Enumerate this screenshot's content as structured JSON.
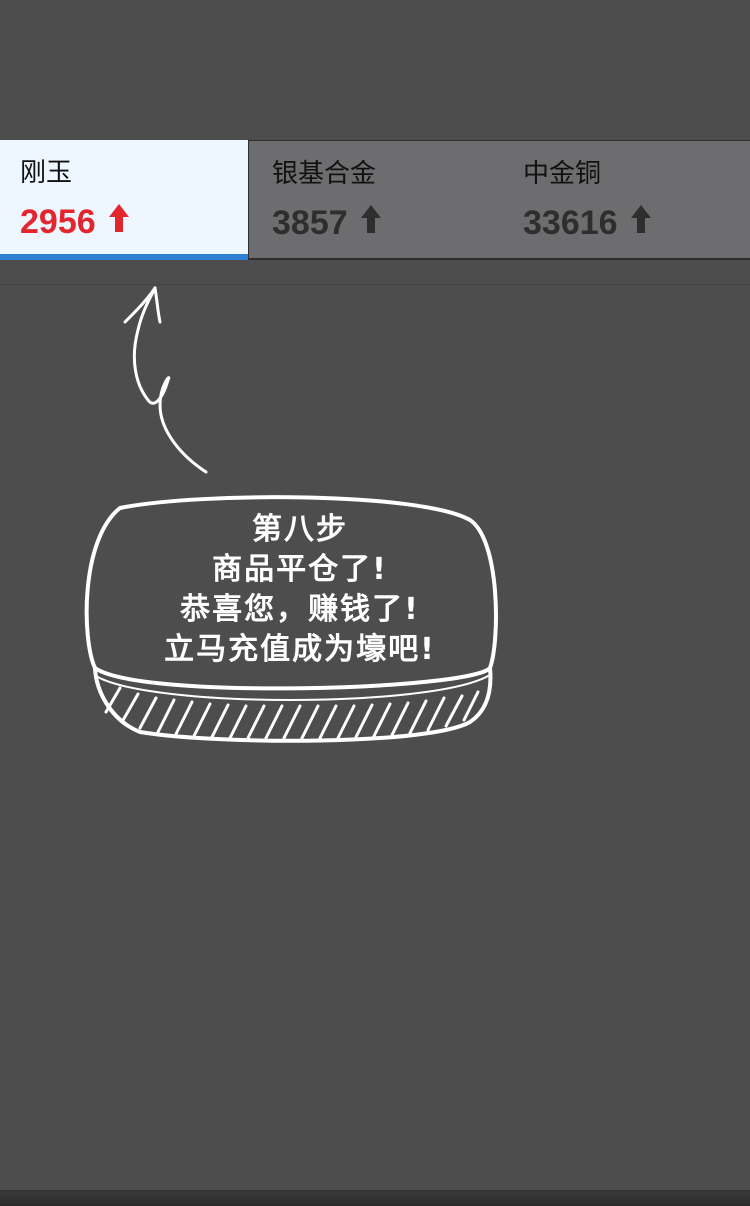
{
  "tickers": [
    {
      "name": "刚玉",
      "price": "2956",
      "trend_icon": "arrow-up-icon",
      "color": "#e3262e",
      "active": true
    },
    {
      "name": "银基合金",
      "price": "3857",
      "trend_icon": "arrow-up-icon",
      "color": "#2e2e2e",
      "active": false
    },
    {
      "name": "中金铜",
      "price": "33616",
      "trend_icon": "arrow-up-icon",
      "color": "#2e2e2e",
      "active": false
    }
  ],
  "colors": {
    "background": "#4d4d4d",
    "active_tab_bg": "#eef6ff",
    "active_underline": "#2f7fd2",
    "inactive_tab_bg": "#6d6d6f",
    "up_red": "#e3262e"
  },
  "tutorial": {
    "line1": "第八步",
    "line2": "商品平仓了!",
    "line3": "恭喜您，赚钱了!",
    "line4": "立马充值成为壕吧!"
  },
  "icons": {
    "pointer": "hand-drawn-arrow-icon",
    "bubble": "speech-bubble"
  }
}
